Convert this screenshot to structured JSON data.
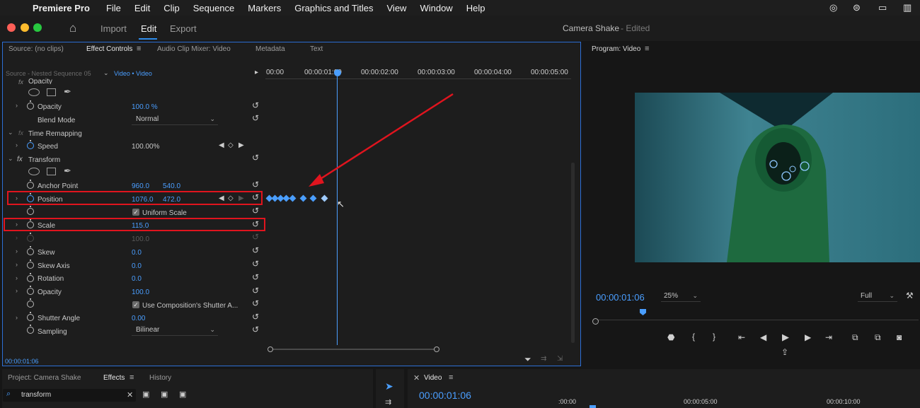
{
  "menubar": {
    "app": "Premiere Pro",
    "items": [
      "File",
      "Edit",
      "Clip",
      "Sequence",
      "Markers",
      "Graphics and Titles",
      "View",
      "Window",
      "Help"
    ]
  },
  "titlebar": {
    "tabs": [
      "Import",
      "Edit",
      "Export"
    ],
    "active_tab": "Edit",
    "project_title": "Camera Shake",
    "edited_suffix": "- Edited"
  },
  "effect_panel": {
    "tabs": [
      "Source: (no clips)",
      "Effect Controls",
      "Audio Clip Mixer: Video",
      "Metadata",
      "Text"
    ],
    "source": "Source - Nested Sequence 05",
    "clip": "Video • Video",
    "ruler": [
      "00:00",
      "00:00:01:00",
      "00:00:02:00",
      "00:00:03:00",
      "00:00:04:00",
      "00:00:05:00"
    ],
    "timecode": "00:00:01:06",
    "rows": {
      "opacity_header": "Opacity",
      "opacity": {
        "label": "Opacity",
        "value": "100.0 %"
      },
      "blend_mode": {
        "label": "Blend Mode",
        "value": "Normal"
      },
      "time_remapping": "Time Remapping",
      "speed": {
        "label": "Speed",
        "value": "100.00%"
      },
      "transform": "Transform",
      "anchor_point": {
        "label": "Anchor Point",
        "x": "960.0",
        "y": "540.0"
      },
      "position": {
        "label": "Position",
        "x": "1076.0",
        "y": "472.0"
      },
      "uniform_scale": "Uniform Scale",
      "scale": {
        "label": "Scale",
        "value": "115.0"
      },
      "scale_width": {
        "value": "100.0"
      },
      "skew": {
        "label": "Skew",
        "value": "0.0"
      },
      "skew_axis": {
        "label": "Skew Axis",
        "value": "0.0"
      },
      "rotation": {
        "label": "Rotation",
        "value": "0.0"
      },
      "opacity2": {
        "label": "Opacity",
        "value": "100.0"
      },
      "shutter_comp": "Use Composition's Shutter A...",
      "shutter_angle": {
        "label": "Shutter Angle",
        "value": "0.00"
      },
      "sampling": {
        "label": "Sampling",
        "value": "Bilinear"
      }
    }
  },
  "program_panel": {
    "title": "Program: Video",
    "timecode": "00:00:01:06",
    "zoom": "25%",
    "quality": "Full"
  },
  "bottom": {
    "project_tab": "Project: Camera Shake",
    "effects_tab": "Effects",
    "history_tab": "History",
    "search_value": "transform",
    "timeline_tab": "Video",
    "timeline_timecode": "00:00:01:06",
    "ruler": [
      ":00:00",
      "00:00:05:00",
      "00:00:10:00"
    ]
  }
}
